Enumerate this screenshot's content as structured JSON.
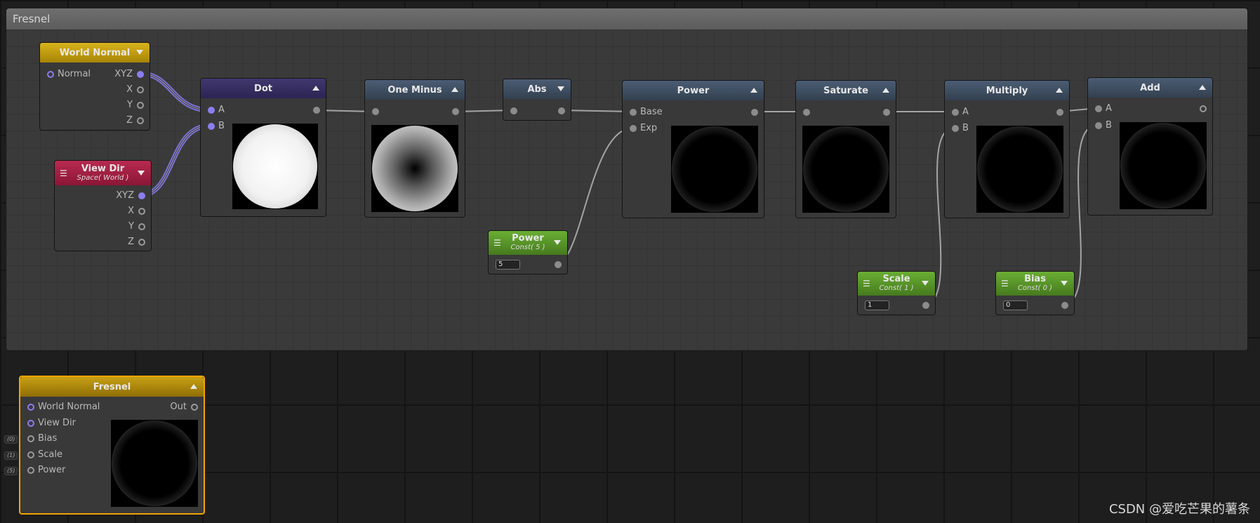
{
  "group": {
    "title": "Fresnel"
  },
  "nodes": {
    "world_normal": {
      "title": "World Normal",
      "in": "Normal",
      "out": [
        "XYZ",
        "X",
        "Y",
        "Z"
      ]
    },
    "view_dir": {
      "title": "View Dir",
      "subtitle": "Space( World )",
      "out": [
        "XYZ",
        "X",
        "Y",
        "Z"
      ]
    },
    "dot": {
      "title": "Dot",
      "in": [
        "A",
        "B"
      ]
    },
    "one_minus": {
      "title": "One Minus"
    },
    "abs": {
      "title": "Abs"
    },
    "power": {
      "title": "Power",
      "in": [
        "Base",
        "Exp"
      ]
    },
    "saturate": {
      "title": "Saturate"
    },
    "multiply": {
      "title": "Multiply",
      "in": [
        "A",
        "B"
      ]
    },
    "add": {
      "title": "Add",
      "in": [
        "A",
        "B"
      ]
    },
    "power_const": {
      "title": "Power",
      "subtitle": "Const( 5 )",
      "value": "5"
    },
    "scale_const": {
      "title": "Scale",
      "subtitle": "Const( 1 )",
      "value": "1"
    },
    "bias_const": {
      "title": "Bias",
      "subtitle": "Const( 0 )",
      "value": "0"
    },
    "fresnel": {
      "title": "Fresnel",
      "in": [
        "World Normal",
        "View Dir",
        "Bias",
        "Scale",
        "Power"
      ],
      "out": "Out",
      "defaults": [
        "(0)",
        "(1)",
        "(5)"
      ]
    }
  },
  "watermark": "CSDN @爱吃芒果的薯条",
  "colors": {
    "vector_port": "#8a7ef0",
    "float_port": "#8c8c8c",
    "selection": "#f2a300",
    "const_header": "#6aae34",
    "world_normal_header": "#d8b21c",
    "view_dir_header": "#b82a50",
    "dot_header": "#41386e",
    "math_header": "#4b5d74"
  },
  "icons": [
    "collapse-arrow-icon",
    "dropdown-arrow-icon",
    "menu-icon"
  ]
}
